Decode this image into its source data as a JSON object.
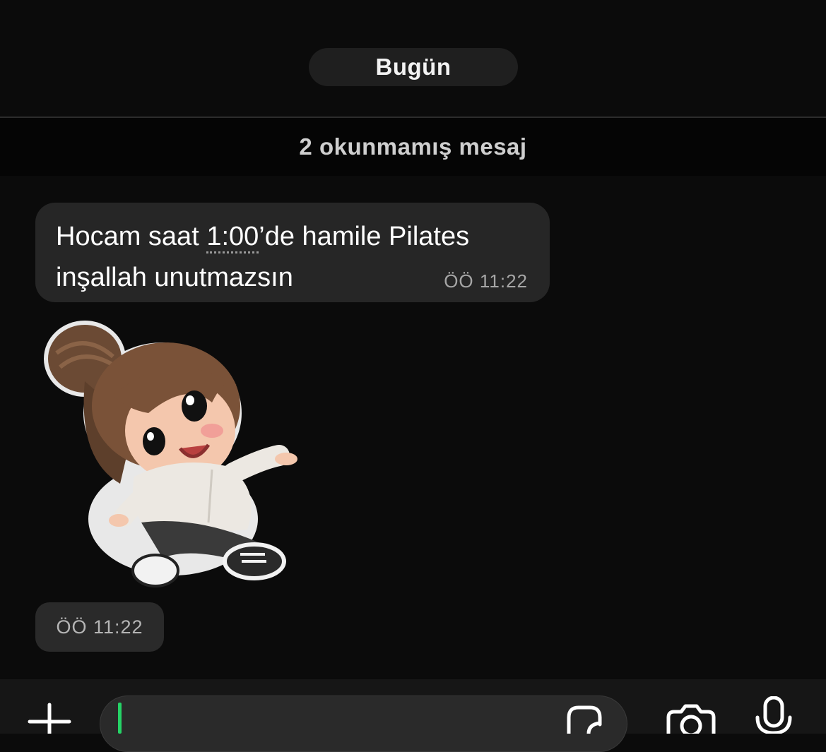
{
  "chat": {
    "date_label": "Bugün",
    "unread_label": "2 okunmamış mesaj",
    "messages": [
      {
        "type": "text",
        "line1_before": "Hocam saat ",
        "line1_time": "1:00",
        "line1_after": "’de hamile Pilates",
        "line2": "inşallah unutmazsın",
        "time": "ÖÖ 11:22"
      },
      {
        "type": "sticker",
        "sticker_description": "cartoon-girl-sticker",
        "time": "ÖÖ 11:22"
      }
    ]
  },
  "composer": {
    "input_value": "",
    "input_placeholder": "",
    "icons": {
      "attach": "plus-icon",
      "sticker": "sticker-icon",
      "camera": "camera-icon",
      "mic": "microphone-icon"
    },
    "accent_color": "#25d366"
  },
  "colors": {
    "background": "#0b0b0b",
    "incoming_bubble": "#262626",
    "chip": "#1f1f1f"
  }
}
